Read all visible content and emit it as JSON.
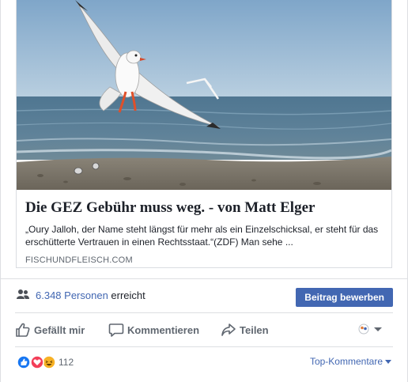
{
  "link_preview": {
    "title": "Die GEZ Gebühr muss weg. - von Matt Elger",
    "description": "„Oury Jalloh, der Name steht längst für mehr als ein Einzelschicksal, er steht für das erschütterte Vertrauen in einen Rechtsstaat.“(ZDF) Man sehe ...",
    "domain": "FISCHUNDFLEISCH.COM"
  },
  "reach": {
    "count": "6.348 Personen",
    "label": "erreicht",
    "boost_label": "Beitrag bewerben"
  },
  "actions": {
    "like_label": "Gefällt mir",
    "comment_label": "Kommentieren",
    "share_label": "Teilen"
  },
  "reactions": {
    "count": "112",
    "types": [
      "like-icon",
      "love-icon",
      "haha-icon"
    ],
    "sort_label": "Top-Kommentare"
  },
  "colors": {
    "accent": "#4267b2",
    "like": "#1877f2",
    "love": "#f33e58",
    "haha": "#f7b125"
  }
}
